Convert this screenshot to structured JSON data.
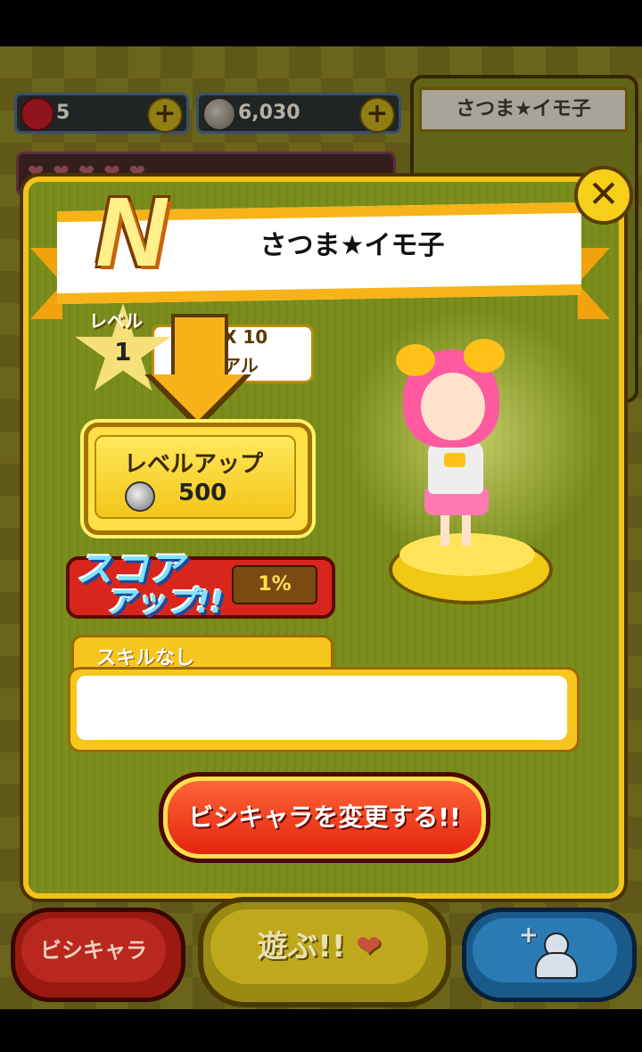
{
  "top_bar": {
    "gems": "5",
    "coins": "6,030"
  },
  "background_card": {
    "name": "さつま★イモ子"
  },
  "character_panel": {
    "rarity": "N",
    "name": "さつま★イモ子",
    "level_label": "レベル",
    "level": "1",
    "max_line1": "X 10",
    "max_line2": "アル",
    "level_up_label": "レベルアップ",
    "level_up_cost": "500",
    "score_up_title1": "スコア",
    "score_up_title2": "アップ!!",
    "score_up_value": "1%",
    "skill_label": "スキルなし",
    "skill_text": "",
    "change_button": "ビシキャラを変更する!!"
  },
  "bottom_nav": {
    "left": "ビシキャラ",
    "middle": "遊ぶ!!",
    "middle_heart": "❤"
  },
  "colors": {
    "panel_border": "#f4c21a",
    "panel_bg": "#7b8e1c",
    "change_button": "#e2200c",
    "score_bar": "#d8261c"
  }
}
